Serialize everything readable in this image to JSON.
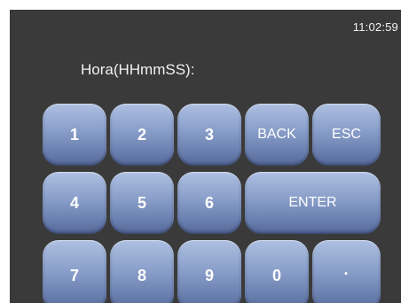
{
  "status": {
    "clock": "11:02:59"
  },
  "form": {
    "prompt_label": "Hora(HHmmSS):"
  },
  "keypad": {
    "k1": "1",
    "k2": "2",
    "k3": "3",
    "back": "BACK",
    "esc": "ESC",
    "k4": "4",
    "k5": "5",
    "k6": "6",
    "enter": "ENTER",
    "k7": "7",
    "k8": "8",
    "k9": "9",
    "k0": "0",
    "dot": "·"
  },
  "colors": {
    "background": "#3a3a3a",
    "key_top": "#aec0e2",
    "key_bottom": "#56699a",
    "text": "#ffffff"
  }
}
